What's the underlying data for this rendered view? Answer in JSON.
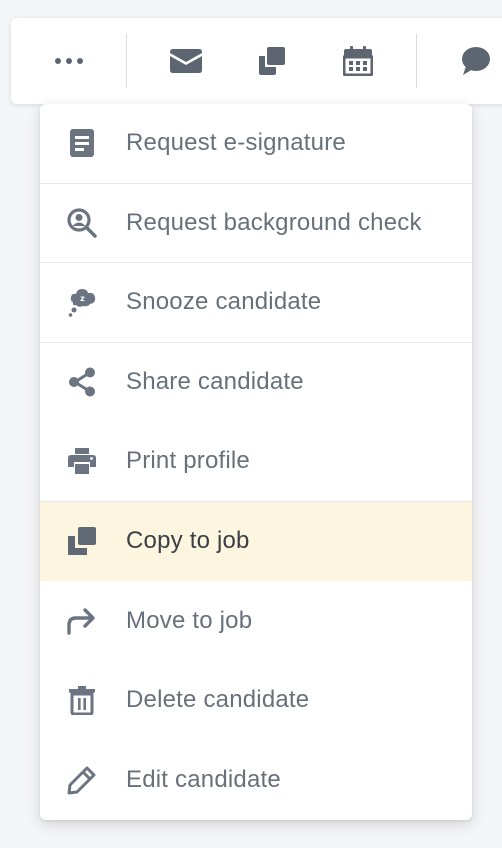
{
  "colors": {
    "icon": "#6b7480",
    "label": "#68707a",
    "highlight_bg": "#fcf5df",
    "separator": "#e6e8eb"
  },
  "toolbar": {
    "buttons": [
      {
        "icon": "more-horizontal-icon"
      },
      {
        "icon": "envelope-icon"
      },
      {
        "icon": "copy-icon"
      },
      {
        "icon": "calendar-icon"
      },
      {
        "icon": "comment-icon"
      }
    ]
  },
  "menu": {
    "items": [
      {
        "label": "Request e-signature",
        "icon": "document-icon"
      },
      {
        "label": "Request background check",
        "icon": "search-person-icon"
      },
      {
        "label": "Snooze candidate",
        "icon": "snooze-icon"
      },
      {
        "label": "Share candidate",
        "icon": "share-icon"
      },
      {
        "label": "Print profile",
        "icon": "printer-icon"
      },
      {
        "label": "Copy to job",
        "icon": "copy-icon",
        "highlighted": true
      },
      {
        "label": "Move to job",
        "icon": "forward-arrow-icon"
      },
      {
        "label": "Delete candidate",
        "icon": "trash-icon"
      },
      {
        "label": "Edit candidate",
        "icon": "pencil-icon"
      }
    ]
  }
}
